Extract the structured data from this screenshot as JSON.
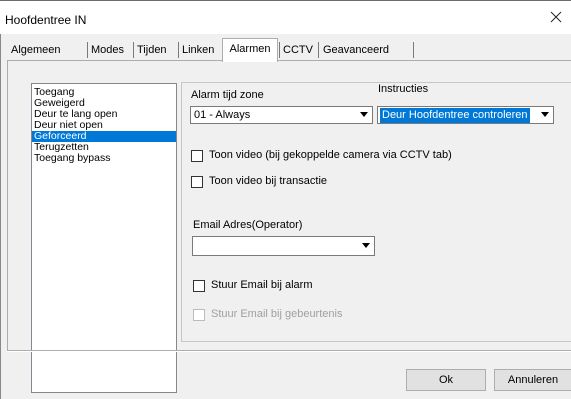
{
  "window": {
    "title": "Hoofdentree IN",
    "close_icon": "close-icon"
  },
  "tabs": [
    {
      "label": "Algemeen"
    },
    {
      "label": "Modes"
    },
    {
      "label": "Tijden"
    },
    {
      "label": "Linken"
    },
    {
      "label": "Alarmen",
      "active": true
    },
    {
      "label": "CCTV"
    },
    {
      "label": "Geavanceerd"
    }
  ],
  "alarm_list": [
    {
      "label": "Toegang"
    },
    {
      "label": "Geweigerd"
    },
    {
      "label": "Deur te lang open"
    },
    {
      "label": "Deur niet open"
    },
    {
      "label": "Geforceerd",
      "selected": true
    },
    {
      "label": "Terugzetten"
    },
    {
      "label": "Toegang bypass"
    }
  ],
  "form": {
    "timezone_label": "Alarm tijd zone",
    "timezone_value": "01 - Always",
    "instructions_label": "Instructies",
    "instructions_value": "Deur Hoofdentree controleren",
    "show_video_label": "Toon video (bij gekoppelde camera via CCTV tab)",
    "show_video_checked": false,
    "show_video_transaction_label": "Toon video bij transactie",
    "show_video_transaction_checked": false,
    "email_label": "Email Adres(Operator)",
    "email_value": "",
    "send_email_alarm_label": "Stuur Email bij alarm",
    "send_email_alarm_checked": false,
    "send_email_event_label": "Stuur Email bij gebeurtenis",
    "send_email_event_checked": false,
    "send_email_event_disabled": true
  },
  "buttons": {
    "ok": "Ok",
    "cancel": "Annuleren"
  },
  "colors": {
    "selection": "#0078d7",
    "background": "#f0f0f0"
  }
}
